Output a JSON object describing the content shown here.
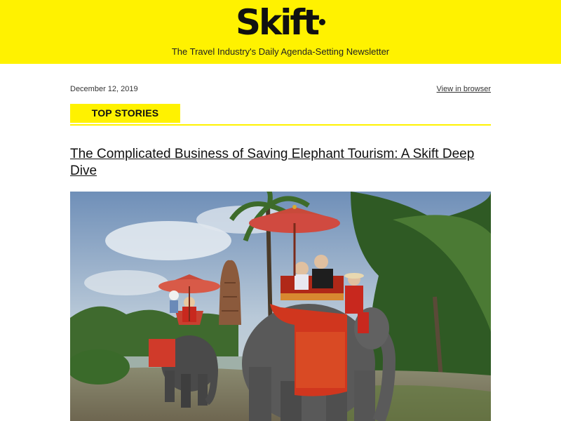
{
  "header": {
    "logo_text": "Skift",
    "tagline": "The Travel Industry's Daily Agenda-Setting Newsletter",
    "background_color": "#fff200"
  },
  "meta": {
    "date": "December 12, 2019",
    "view_in_browser": "View in browser"
  },
  "section": {
    "label": "TOP STORIES"
  },
  "article": {
    "headline": "The Complicated Business of Saving Elephant Tourism: A Skift Deep Dive",
    "image_icon": "elephant-photo"
  }
}
